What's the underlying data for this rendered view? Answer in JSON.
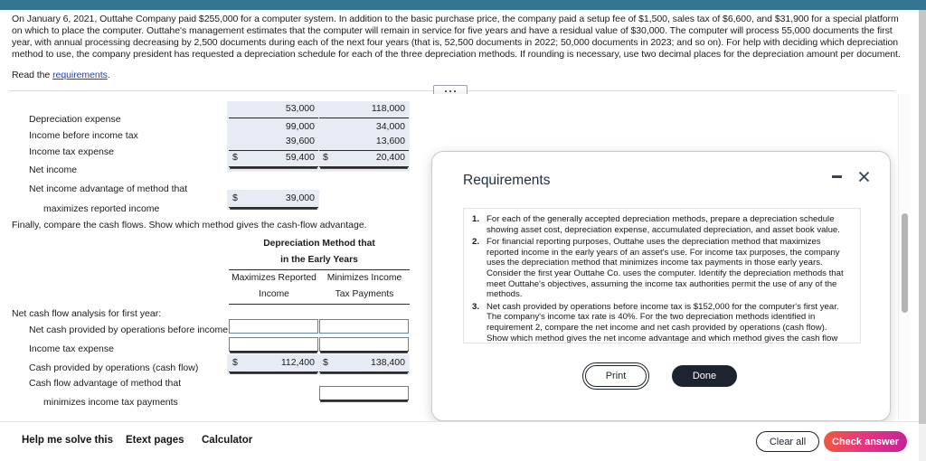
{
  "problem": {
    "paragraph": "On January 6, 2021, Outtahe Company paid $255,000 for a computer system. In addition to the basic purchase price, the company paid a setup fee of $1,500, sales tax of $6,600, and $31,900 for a special platform on which to place the computer. Outtahe's management estimates that the computer will remain in service for five years and have a residual value of $30,000. The computer will process 55,000 documents the first year, with annual processing decreasing by 2,500 documents during each of the next four years (that is, 52,500 documents in 2022; 50,000 documents in 2023; and so on). For help with deciding which depreciation method to use, the company president has requested a depreciation schedule for each of the three depreciation methods. If rounding is necessary, use two decimal places for the depreciation amount per document.",
    "read_prefix": "Read the ",
    "read_link": "requirements",
    "read_suffix": "."
  },
  "income_table": {
    "rows": [
      {
        "label": "Depreciation expense",
        "col1": "53,000",
        "col2": "118,000",
        "dollar1": "",
        "dollar2": ""
      },
      {
        "label": "Income before income tax",
        "col1": "99,000",
        "col2": "34,000",
        "dollar1": "",
        "dollar2": ""
      },
      {
        "label": "Income tax expense",
        "col1": "39,600",
        "col2": "13,600",
        "dollar1": "",
        "dollar2": ""
      },
      {
        "label": "Net income",
        "col1": "59,400",
        "col2": "20,400",
        "dollar1": "$",
        "dollar2": "$"
      }
    ],
    "advantage_label_line1": "Net income advantage of method that",
    "advantage_label_line2": "maximizes reported income",
    "advantage_dollar": "$",
    "advantage_value": "39,000"
  },
  "transition_text": "Finally, compare the cash flows. Show which method gives the cash-flow advantage.",
  "cashflow_table": {
    "header_line1": "Depreciation Method that",
    "header_line2": "in the Early Years",
    "col1_line1": "Maximizes Reported",
    "col1_line2": "Income",
    "col2_line1": "Minimizes Income",
    "col2_line2": "Tax Payments",
    "section_label": "Net cash flow analysis for first year:",
    "rows": [
      {
        "label": "Net cash provided by operations before income tax",
        "type": "input",
        "col1": "",
        "col2": ""
      },
      {
        "label": "Income tax expense",
        "type": "input",
        "col1": "",
        "col2": ""
      },
      {
        "label": "Cash provided by operations (cash flow)",
        "type": "value",
        "dollar1": "$",
        "col1": "112,400",
        "dollar2": "$",
        "col2": "138,400"
      }
    ],
    "advantage_label_line1": "Cash flow advantage of method that",
    "advantage_label_line2": "minimizes income tax payments",
    "advantage_value": ""
  },
  "dialog": {
    "title": "Requirements",
    "minimize_icon": "minimize-icon",
    "close_icon": "close-icon",
    "requirements": [
      {
        "num": "1.",
        "text": "For each of the generally accepted depreciation methods, prepare a depreciation schedule showing asset cost, depreciation expense, accumulated depreciation, and asset book value."
      },
      {
        "num": "2.",
        "text": "For financial reporting purposes, Outtahe uses the depreciation method that maximizes reported income in the early years of an asset's use. For income tax purposes, the company uses the depreciation method that minimizes income tax payments in those early years. Consider the first year Outtahe Co. uses the computer. Identify the depreciation methods that meet Outtahe's objectives, assuming the income tax authorities permit the use of any of the methods."
      },
      {
        "num": "3.",
        "text": "Net cash provided by operations before income tax is $152,000 for the computer's first year. The company's income tax rate is 40%. For the two depreciation methods identified in requirement 2, compare the net income and net cash provided by operations (cash flow). Show which method gives the net income advantage and which method gives the cash flow advantage."
      }
    ],
    "print_label": "Print",
    "done_label": "Done"
  },
  "bottom_toolbar": {
    "links": [
      {
        "label": "Help me solve this"
      },
      {
        "label": "Etext pages"
      },
      {
        "label": "Calculator"
      }
    ],
    "clear_all_label": "Clear all",
    "check_answer_label": "Check answer"
  },
  "colors": {
    "topbar": "#36758f",
    "accent_link": "#1a3fd0",
    "value_block": "#e7ebf3",
    "input_border": "#5b87a3",
    "check_gradient_start": "#ef5a3c",
    "check_gradient_end": "#c5229b",
    "dark_button": "#1d2430"
  }
}
